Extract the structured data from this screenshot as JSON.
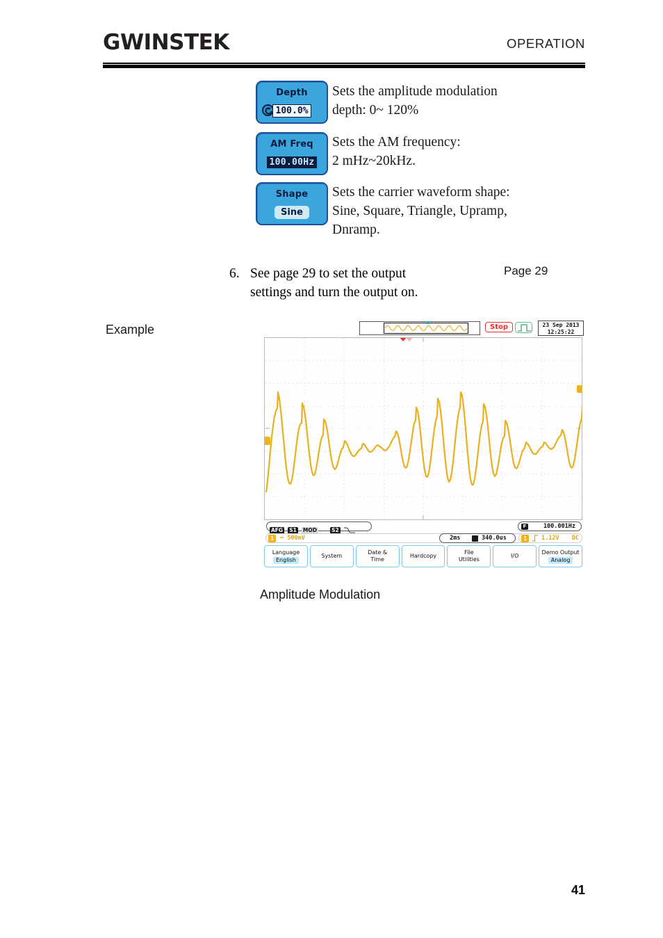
{
  "header": {
    "logo": "GWINSTEK",
    "section_title": "OPERATION"
  },
  "params": [
    {
      "key_title": "Depth",
      "key_value": "100.0%",
      "icon": "rotary-knob-icon",
      "description_line1": "Sets the amplitude modulation",
      "description_line2": "depth:  0~ 120%"
    },
    {
      "key_title": "AM Freq",
      "key_value": "100.00Hz",
      "description_line1": "Sets the AM frequency:",
      "description_line2": "2 mHz~20kHz."
    },
    {
      "key_title": "Shape",
      "key_value": "Sine",
      "description_line1": "Sets the carrier waveform shape:",
      "description_line2": "Sine, Square, Triangle, Upramp,",
      "description_line3": "Dnramp."
    }
  ],
  "step": {
    "number": "6.",
    "line1": "See page 29 to set the output",
    "line2": "settings and turn the output on.",
    "page_reference": "Page 29"
  },
  "example": {
    "label": "Example",
    "caption": "Amplitude Modulation"
  },
  "scope": {
    "run_state": "Stop",
    "date": "23 Sep 2013",
    "time": "12:25:22",
    "status": {
      "badge_afg": "AFG",
      "badge_s1": "S1",
      "badge_mod": "MOD",
      "badge_s2": "S2"
    },
    "frequency_counter": {
      "label": "F",
      "value": "100.001Hz"
    },
    "channel1": {
      "label": "1",
      "coupling_symbol": "═",
      "scale": "500mV"
    },
    "timebase": {
      "scale": "2ms",
      "position": "340.0us"
    },
    "trigger": {
      "source": "1",
      "slope": "rising-edge",
      "level": "1.12V",
      "coupling": "DC"
    },
    "menu": [
      {
        "main": "Language",
        "sub": "English"
      },
      {
        "main": "System",
        "sub": ""
      },
      {
        "main": "Date &",
        "main2": "Time",
        "sub": ""
      },
      {
        "main": "Hardcopy",
        "sub": ""
      },
      {
        "main": "File",
        "main2": "Utilities",
        "sub": ""
      },
      {
        "main": "I/O",
        "sub": ""
      },
      {
        "main": "Demo Output",
        "sub": "Analog"
      }
    ]
  },
  "colors": {
    "softkey_blue": "#3ba6de",
    "softkey_border": "#1c4f9c",
    "waveform_yellow": "#e8b020",
    "stop_red": "#ef2b2b",
    "pulse_green": "#5ec98a",
    "menu_highlight": "#bfeaf7"
  },
  "footer": {
    "page_number": "41"
  }
}
